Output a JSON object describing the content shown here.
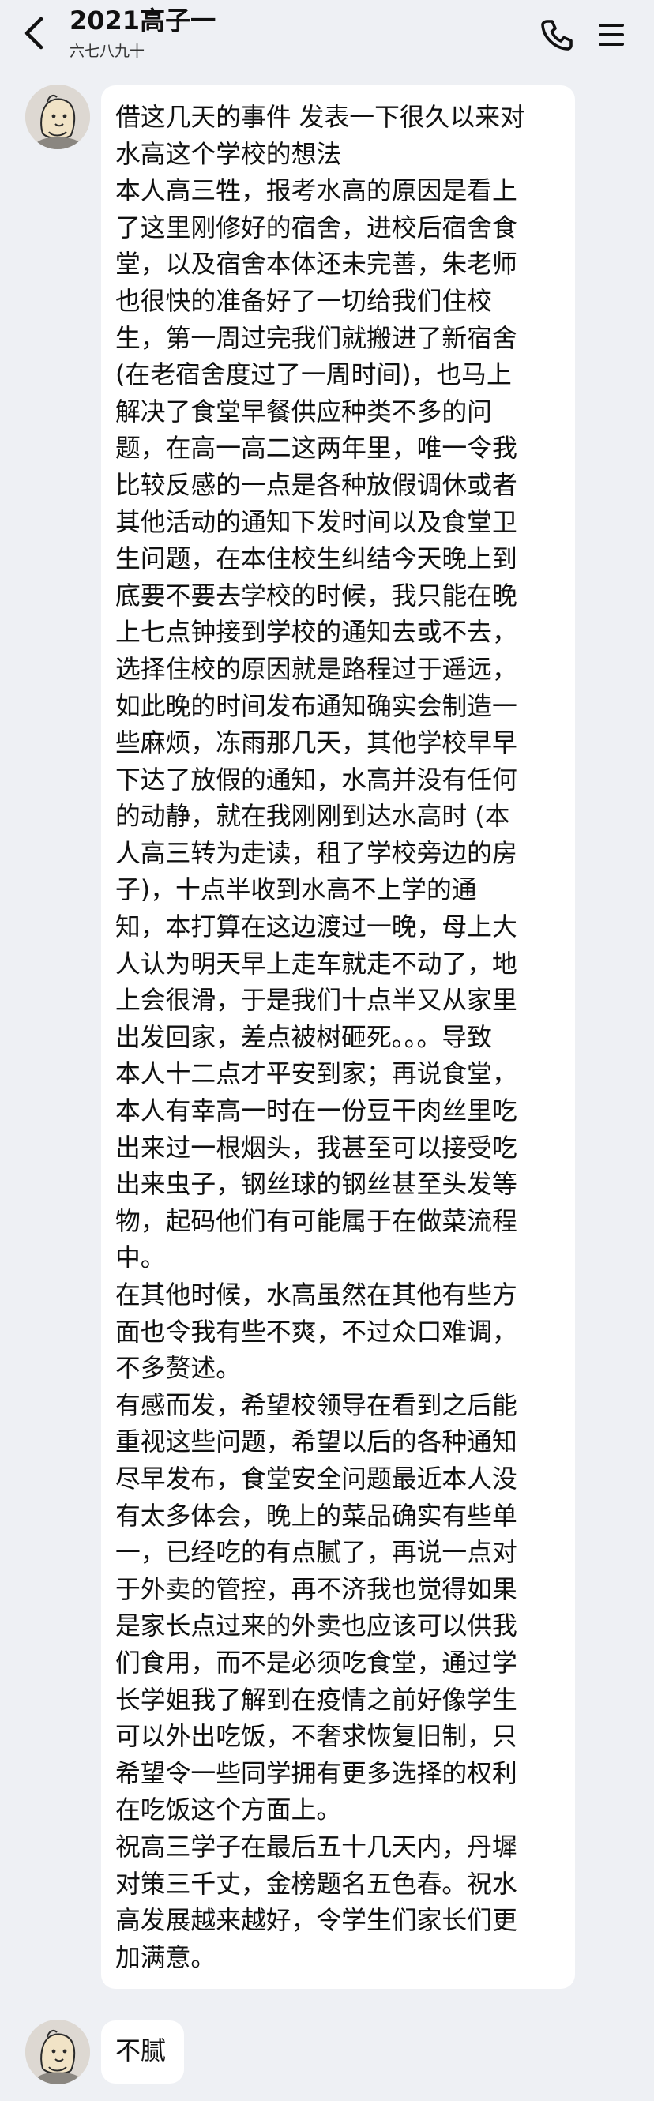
{
  "header": {
    "title": "2021高子一",
    "subtitle": "六七八九十",
    "back_icon": "chevron-left-icon",
    "call_icon": "phone-icon",
    "menu_icon": "hamburger-menu-icon"
  },
  "messages": [
    {
      "sender_avatar": "cartoon-character-avatar",
      "lines": [
        "借这几天的事件 发表一下很久以来对",
        "水高这个学校的想法",
        "本人高三牲，报考水高的原因是看上",
        "了这里刚修好的宿舍，进校后宿舍食",
        "堂，以及宿舍本体还未完善，朱老师",
        "也很快的准备好了一切给我们住校",
        "生，第一周过完我们就搬进了新宿舍",
        "(在老宿舍度过了一周时间)，也马上",
        "解决了食堂早餐供应种类不多的问",
        "题，在高一高二这两年里，唯一令我",
        "比较反感的一点是各种放假调休或者",
        "其他活动的通知下发时间以及食堂卫",
        "生问题，在本住校生纠结今天晚上到",
        "底要不要去学校的时候，我只能在晚",
        "上七点钟接到学校的通知去或不去，",
        "选择住校的原因就是路程过于遥远，",
        "如此晚的时间发布通知确实会制造一",
        "些麻烦，冻雨那几天，其他学校早早",
        "下达了放假的通知，水高并没有任何",
        "的动静，就在我刚刚到达水高时 (本",
        "人高三转为走读，租了学校旁边的房",
        "子)，十点半收到水高不上学的通",
        "知，本打算在这边渡过一晚，母上大",
        "人认为明天早上走车就走不动了，地",
        "上会很滑，于是我们十点半又从家里",
        "出发回家，差点被树砸死。。。导致",
        "本人十二点才平安到家；再说食堂，",
        "本人有幸高一时在一份豆干肉丝里吃",
        "出来过一根烟头，我甚至可以接受吃",
        "出来虫子，钢丝球的钢丝甚至头发等",
        "物，起码他们有可能属于在做菜流程",
        "中。",
        "在其他时候，水高虽然在其他有些方",
        "面也令我有些不爽，不过众口难调，",
        "不多赘述。",
        "有感而发，希望校领导在看到之后能",
        "重视这些问题，希望以后的各种通知",
        "尽早发布，食堂安全问题最近本人没",
        "有太多体会，晚上的菜品确实有些单",
        "一，已经吃的有点腻了，再说一点对",
        "于外卖的管控，再不济我也觉得如果",
        "是家长点过来的外卖也应该可以供我",
        "们食用，而不是必须吃食堂，通过学",
        "长学姐我了解到在疫情之前好像学生",
        "可以外出吃饭，不奢求恢复旧制，只",
        "希望令一些同学拥有更多选择的权利",
        "在吃饭这个方面上。",
        "祝高三学子在最后五十几天内，丹墀",
        "对策三千丈，金榜题名五色春。祝水",
        "高发展越来越好，令学生们家长们更",
        "加满意。"
      ]
    },
    {
      "sender_avatar": "cartoon-character-avatar",
      "text": "不腻"
    }
  ]
}
